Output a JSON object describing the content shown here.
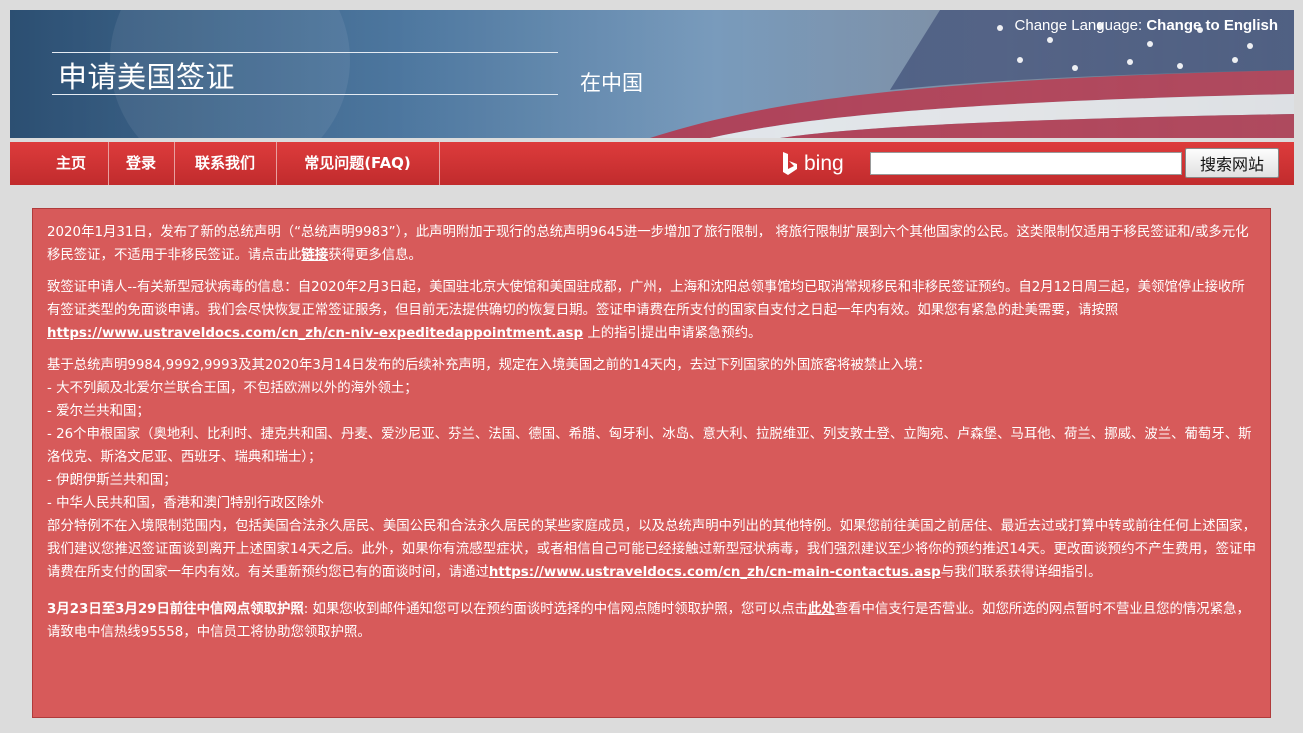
{
  "header": {
    "language_label": "Change Language:",
    "language_link": "Change to English",
    "title": "申请美国签证",
    "subtitle": "在中国"
  },
  "nav": {
    "items": [
      "主页",
      "登录",
      "联系我们",
      "常见问题(FAQ)"
    ],
    "bing_label": "bing",
    "search_placeholder": "",
    "search_button": "搜索网站"
  },
  "notice": {
    "p1_text": "2020年1月31日，发布了新的总统声明（“总统声明9983”），此声明附加于现行的总统声明9645进一步增加了旅行限制， 将旅行限制扩展到六个其他国家的公民。这类限制仅适用于移民签证和/或多元化移民签证，不适用于非移民签证。请点击此",
    "p1_link": "链接",
    "p1_tail": "获得更多信息。",
    "p2_text": "致签证申请人--有关新型冠状病毒的信息：自2020年2月3日起，美国驻北京大使馆和美国驻成都，广州，上海和沈阳总领事馆均已取消常规移民和非移民签证预约。自2月12日周三起，美领馆停止接收所有签证类型的免面谈申请。我们会尽快恢复正常签证服务，但目前无法提供确切的恢复日期。签证申请费在所支付的国家自支付之日起一年内有效。如果您有紧急的赴美需要，请按照",
    "p2_link": "https://www.ustraveldocs.com/cn_zh/cn-niv-expeditedappointment.asp",
    "p2_tail": " 上的指引提出申请紧急预约。",
    "p3_intro": "基于总统声明9984,9992,9993及其2020年3月14日发布的后续补充声明，规定在入境美国之前的14天内，去过下列国家的外国旅客将被禁止入境：",
    "p3_list": [
      "- 大不列颠及北爱尔兰联合王国，不包括欧洲以外的海外领土；",
      "- 爱尔兰共和国；",
      "- 26个申根国家（奥地利、比利时、捷克共和国、丹麦、爱沙尼亚、芬兰、法国、德国、希腊、匈牙利、冰岛、意大利、拉脱维亚、列支敦士登、立陶宛、卢森堡、马耳他、荷兰、挪威、波兰、葡萄牙、斯洛伐克、斯洛文尼亚、西班牙、瑞典和瑞士）；",
      "- 伊朗伊斯兰共和国；",
      "- 中华人民共和国，香港和澳门特别行政区除外"
    ],
    "p3_text": "部分特例不在入境限制范围内，包括美国合法永久居民、美国公民和合法永久居民的某些家庭成员，以及总统声明中列出的其他特例。如果您前往美国之前居住、最近去过或打算中转或前往任何上述国家，我们建议您推迟签证面谈到离开上述国家14天之后。此外，如果你有流感型症状，或者相信自己可能已经接触过新型冠状病毒，我们强烈建议至少将你的预约推迟14天。更改面谈预约不产生费用，签证申请费在所支付的国家一年内有效。有关重新预约您已有的面谈时间，请通过",
    "p3_link": "https://www.ustraveldocs.com/cn_zh/cn-main-contactus.asp",
    "p3_tail": "与我们联系获得详细指引。",
    "p4_head": "3月23日至3月29日前往中信网点领取护照",
    "p4_text": ": 如果您收到邮件通知您可以在预约面谈时选择的中信网点随时领取护照，您可以点击",
    "p4_link": "此处",
    "p4_tail": "查看中信支行是否营业。如您所选的网点暂时不营业且您的情况紧急，请致电中信热线95558，中信员工将协助您领取护照。"
  },
  "colors": {
    "nav_red": "#c12b2d",
    "notice_bg": "#d75a5a",
    "page_bg": "#dcdcdc"
  }
}
